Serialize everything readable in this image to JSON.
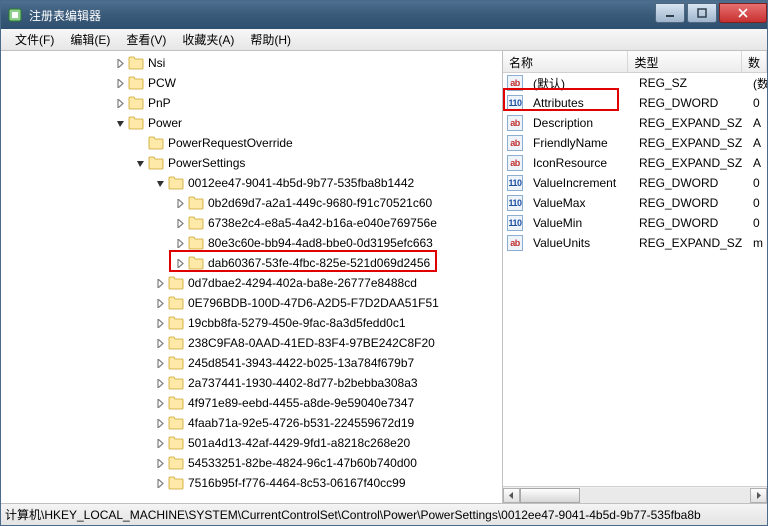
{
  "window": {
    "title": "注册表编辑器"
  },
  "menu": {
    "file": "文件(F)",
    "edit": "编辑(E)",
    "view": "查看(V)",
    "favorites": "收藏夹(A)",
    "help": "帮助(H)"
  },
  "tree": {
    "highlightTop": 199,
    "highlightLeft": 168,
    "highlightWidth": 268,
    "highlightHeight": 22,
    "items": [
      {
        "indent": 114,
        "kind": "collapsed",
        "label": "Nsi"
      },
      {
        "indent": 114,
        "kind": "collapsed",
        "label": "PCW"
      },
      {
        "indent": 114,
        "kind": "collapsed",
        "label": "PnP"
      },
      {
        "indent": 114,
        "kind": "expanded-dark",
        "label": "Power"
      },
      {
        "indent": 134,
        "kind": "leaf",
        "label": "PowerRequestOverride"
      },
      {
        "indent": 134,
        "kind": "expanded-dark",
        "label": "PowerSettings"
      },
      {
        "indent": 154,
        "kind": "expanded-dark",
        "label": "0012ee47-9041-4b5d-9b77-535fba8b1442"
      },
      {
        "indent": 174,
        "kind": "collapsed",
        "label": "0b2d69d7-a2a1-449c-9680-f91c70521c60"
      },
      {
        "indent": 174,
        "kind": "collapsed",
        "label": "6738e2c4-e8a5-4a42-b16a-e040e769756e"
      },
      {
        "indent": 174,
        "kind": "collapsed",
        "label": "80e3c60e-bb94-4ad8-bbe0-0d3195efc663"
      },
      {
        "indent": 174,
        "kind": "collapsed",
        "label": "dab60367-53fe-4fbc-825e-521d069d2456"
      },
      {
        "indent": 154,
        "kind": "collapsed",
        "label": "0d7dbae2-4294-402a-ba8e-26777e8488cd"
      },
      {
        "indent": 154,
        "kind": "collapsed",
        "label": "0E796BDB-100D-47D6-A2D5-F7D2DAA51F51"
      },
      {
        "indent": 154,
        "kind": "collapsed",
        "label": "19cbb8fa-5279-450e-9fac-8a3d5fedd0c1"
      },
      {
        "indent": 154,
        "kind": "collapsed",
        "label": "238C9FA8-0AAD-41ED-83F4-97BE242C8F20"
      },
      {
        "indent": 154,
        "kind": "collapsed",
        "label": "245d8541-3943-4422-b025-13a784f679b7"
      },
      {
        "indent": 154,
        "kind": "collapsed",
        "label": "2a737441-1930-4402-8d77-b2bebba308a3"
      },
      {
        "indent": 154,
        "kind": "collapsed",
        "label": "4f971e89-eebd-4455-a8de-9e59040e7347"
      },
      {
        "indent": 154,
        "kind": "collapsed",
        "label": "4faab71a-92e5-4726-b531-224559672d19"
      },
      {
        "indent": 154,
        "kind": "collapsed",
        "label": "501a4d13-42af-4429-9fd1-a8218c268e20"
      },
      {
        "indent": 154,
        "kind": "collapsed",
        "label": "54533251-82be-4824-96c1-47b60b740d00"
      },
      {
        "indent": 154,
        "kind": "collapsed",
        "label": "7516b95f-f776-4464-8c53-06167f40cc99"
      }
    ]
  },
  "list": {
    "headers": {
      "name": "名称",
      "type": "类型",
      "data": "数"
    },
    "highlightTop": 15,
    "highlightLeft": 0,
    "highlightWidth": 116,
    "highlightHeight": 23,
    "rows": [
      {
        "icon": "str",
        "name": "(默认)",
        "type": "REG_SZ",
        "data": "(数"
      },
      {
        "icon": "dw",
        "name": "Attributes",
        "type": "REG_DWORD",
        "data": "0"
      },
      {
        "icon": "str",
        "name": "Description",
        "type": "REG_EXPAND_SZ",
        "data": "A"
      },
      {
        "icon": "str",
        "name": "FriendlyName",
        "type": "REG_EXPAND_SZ",
        "data": "A"
      },
      {
        "icon": "str",
        "name": "IconResource",
        "type": "REG_EXPAND_SZ",
        "data": "A"
      },
      {
        "icon": "dw",
        "name": "ValueIncrement",
        "type": "REG_DWORD",
        "data": "0"
      },
      {
        "icon": "dw",
        "name": "ValueMax",
        "type": "REG_DWORD",
        "data": "0"
      },
      {
        "icon": "dw",
        "name": "ValueMin",
        "type": "REG_DWORD",
        "data": "0"
      },
      {
        "icon": "str",
        "name": "ValueUnits",
        "type": "REG_EXPAND_SZ",
        "data": "m"
      }
    ]
  },
  "statusbar": {
    "path": "计算机\\HKEY_LOCAL_MACHINE\\SYSTEM\\CurrentControlSet\\Control\\Power\\PowerSettings\\0012ee47-9041-4b5d-9b77-535fba8b"
  }
}
